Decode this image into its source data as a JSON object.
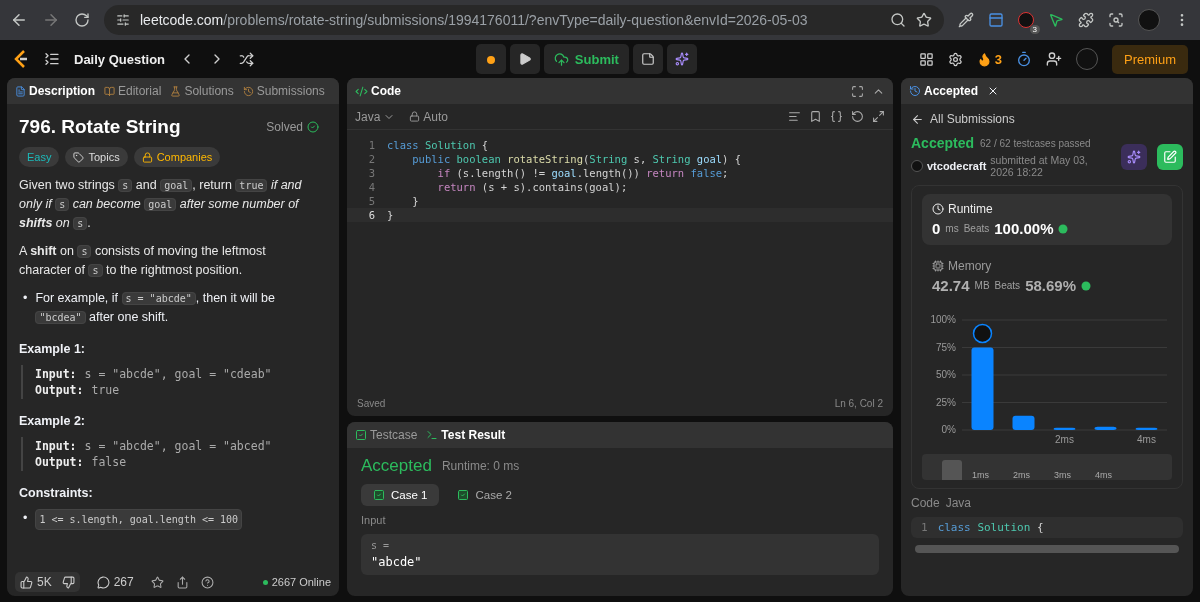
{
  "browser": {
    "url_host": "leetcode.com",
    "url_path": "/problems/rotate-string/submissions/1994176011/?envType=daily-question&envId=2026-05-03",
    "extension_badge": "3"
  },
  "navbar": {
    "title": "Daily Question",
    "submit": "Submit",
    "streak": "3",
    "premium": "Premium"
  },
  "left_panel": {
    "tabs": [
      {
        "label": "Description",
        "selected": true
      },
      {
        "label": "Editorial",
        "selected": false
      },
      {
        "label": "Solutions",
        "selected": false
      },
      {
        "label": "Submissions",
        "selected": false
      }
    ],
    "title": "796. Rotate String",
    "status": "Solved",
    "tags": [
      {
        "label": "Easy",
        "kind": "difficulty"
      },
      {
        "label": "Topics",
        "kind": "topics"
      },
      {
        "label": "Companies",
        "kind": "companies"
      }
    ],
    "paragraphs": [
      [
        {
          "text": "Given two strings ",
          "kind": "plain"
        },
        {
          "text": "s",
          "kind": "code"
        },
        {
          "text": " and ",
          "kind": "plain"
        },
        {
          "text": "goal",
          "kind": "code"
        },
        {
          "text": ", return ",
          "kind": "plain"
        },
        {
          "text": "true",
          "kind": "code"
        },
        {
          "text": " if and only if ",
          "kind": "italic"
        },
        {
          "text": "s",
          "kind": "code"
        },
        {
          "text": " can become ",
          "kind": "italic"
        },
        {
          "text": "goal",
          "kind": "code"
        },
        {
          "text": " after some number of ",
          "kind": "italic"
        },
        {
          "text": "shifts",
          "kind": "bolditalic"
        },
        {
          "text": " on ",
          "kind": "italic"
        },
        {
          "text": "s",
          "kind": "code"
        },
        {
          "text": ".",
          "kind": "plain"
        }
      ],
      [
        {
          "text": "A ",
          "kind": "plain"
        },
        {
          "text": "shift",
          "kind": "bold"
        },
        {
          "text": " on ",
          "kind": "plain"
        },
        {
          "text": "s",
          "kind": "code"
        },
        {
          "text": " consists of moving the leftmost character of ",
          "kind": "plain"
        },
        {
          "text": "s",
          "kind": "code"
        },
        {
          "text": " to the rightmost position.",
          "kind": "plain"
        }
      ]
    ],
    "bullets": [
      {
        "marker": "•",
        "segments": [
          {
            "text": "For example, if ",
            "kind": "plain"
          },
          {
            "text": "s = \"abcde\"",
            "kind": "code"
          },
          {
            "text": ", then it will be ",
            "kind": "plain"
          },
          {
            "text": "\"bcdea\"",
            "kind": "code"
          },
          {
            "text": " after one shift.",
            "kind": "plain"
          }
        ]
      }
    ],
    "examples": [
      {
        "title": "Example 1:",
        "input_label": "Input:",
        "input": "s = \"abcde\", goal = \"cdeab\"",
        "output_label": "Output:",
        "output": "true"
      },
      {
        "title": "Example 2:",
        "input_label": "Input:",
        "input": "s = \"abcde\", goal = \"abced\"",
        "output_label": "Output:",
        "output": "false"
      }
    ],
    "constraints_title": "Constraints:",
    "constraints": [
      {
        "marker": "•",
        "text": "1 <= s.length, goal.length <= 100"
      }
    ],
    "footer": {
      "likes": "5K",
      "comments": "267",
      "online": "2667 Online"
    }
  },
  "code_panel": {
    "title": "Code",
    "language": "Java",
    "mode": "Auto",
    "lines": [
      {
        "number": "1",
        "current": false,
        "tokens": [
          {
            "text": "class ",
            "kind": "decl"
          },
          {
            "text": "Solution",
            "kind": "type"
          },
          {
            "text": " {",
            "kind": "plain"
          }
        ]
      },
      {
        "number": "2",
        "current": false,
        "tokens": [
          {
            "text": "    public ",
            "kind": "decl"
          },
          {
            "text": "boolean ",
            "kind": "type"
          },
          {
            "text": "rotateString",
            "kind": "fn"
          },
          {
            "text": "(",
            "kind": "plain"
          },
          {
            "text": "String ",
            "kind": "type"
          },
          {
            "text": "s, ",
            "kind": "plain"
          },
          {
            "text": "String ",
            "kind": "type"
          },
          {
            "text": "goal",
            "kind": "var"
          },
          {
            "text": ") {",
            "kind": "plain"
          }
        ]
      },
      {
        "number": "3",
        "current": false,
        "tokens": [
          {
            "text": "        if ",
            "kind": "kw"
          },
          {
            "text": "(s.length() != ",
            "kind": "plain"
          },
          {
            "text": "goal",
            "kind": "var"
          },
          {
            "text": ".length()) ",
            "kind": "plain"
          },
          {
            "text": "return ",
            "kind": "kw"
          },
          {
            "text": "false",
            "kind": "decl"
          },
          {
            "text": ";",
            "kind": "plain"
          }
        ]
      },
      {
        "number": "4",
        "current": false,
        "tokens": [
          {
            "text": "        return ",
            "kind": "kw"
          },
          {
            "text": "(s + s).contains(goal);",
            "kind": "plain"
          }
        ]
      },
      {
        "number": "5",
        "current": false,
        "tokens": [
          {
            "text": "    }",
            "kind": "plain"
          }
        ]
      },
      {
        "number": "6",
        "current": true,
        "tokens": [
          {
            "text": "}",
            "kind": "plain"
          }
        ]
      }
    ],
    "save_status": "Saved",
    "cursor": "Ln 6, Col 2"
  },
  "test_panel": {
    "tabs": [
      {
        "label": "Testcase",
        "selected": false
      },
      {
        "label": "Test Result",
        "selected": true
      }
    ],
    "verdict": "Accepted",
    "runtime": "Runtime: 0 ms",
    "cases": [
      {
        "label": "Case 1",
        "selected": true
      },
      {
        "label": "Case 2",
        "selected": false
      }
    ],
    "input_label": "Input",
    "variable": "s =",
    "value": "\"abcde\""
  },
  "submission_panel": {
    "tab": "Accepted",
    "back": "All Submissions",
    "verdict": "Accepted",
    "passed": "62 / 62 testcases passed",
    "user": "vtcodecraft",
    "submitted": "submitted at May 03, 2026 18:22",
    "metrics": [
      {
        "title": "Runtime",
        "value": "0",
        "unit": "ms",
        "beats_label": "Beats",
        "beats": "100.00%",
        "selected": true,
        "kind": "runtime"
      },
      {
        "title": "Memory",
        "value": "42.74",
        "unit": "MB",
        "beats_label": "Beats",
        "beats": "58.69%",
        "selected": false,
        "kind": "memory"
      }
    ],
    "chart_data": {
      "type": "bar",
      "grid": true,
      "x": [
        0,
        1,
        2,
        3,
        4
      ],
      "values": [
        75,
        13,
        2,
        3,
        2
      ],
      "xlim": [
        -0.5,
        4.5
      ],
      "ylim": [
        0,
        100
      ],
      "yticks": [
        {
          "value": 0,
          "label": "0%"
        },
        {
          "value": 25,
          "label": "25%"
        },
        {
          "value": 50,
          "label": "50%"
        },
        {
          "value": 75,
          "label": "75%"
        },
        {
          "value": 100,
          "label": "100%"
        }
      ],
      "xticks": [
        {
          "value": 2,
          "label": "2ms"
        },
        {
          "value": 4,
          "label": "4ms"
        }
      ]
    },
    "range_labels": [
      "1ms",
      "2ms",
      "3ms",
      "4ms"
    ],
    "code_label": "Code",
    "code_language": "Java",
    "code_preview_number": "1",
    "code_preview": [
      {
        "text": "class ",
        "kind": "decl"
      },
      {
        "text": "Solution",
        "kind": "type"
      },
      {
        "text": " {",
        "kind": "plain"
      }
    ]
  }
}
